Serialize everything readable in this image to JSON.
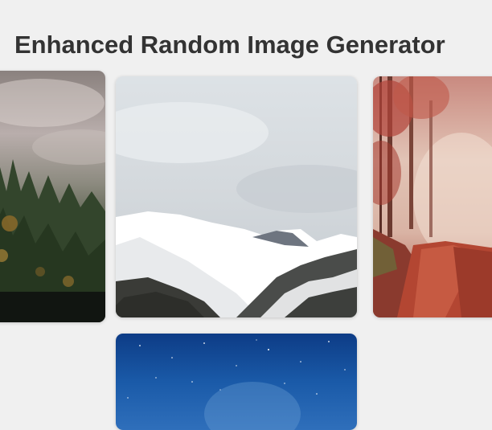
{
  "header": {
    "title": "Enhanced Random Image Generator"
  },
  "gallery": {
    "images": [
      {
        "subject": "misty pine forest",
        "icon": "forest-photo"
      },
      {
        "subject": "snowy mountain ridge",
        "icon": "mountain-photo"
      },
      {
        "subject": "autumn forest path",
        "icon": "autumn-path-photo"
      },
      {
        "subject": "starry night sky",
        "icon": "night-sky-photo"
      }
    ]
  },
  "colors": {
    "background": "#f0f0f0",
    "title": "#333333"
  }
}
